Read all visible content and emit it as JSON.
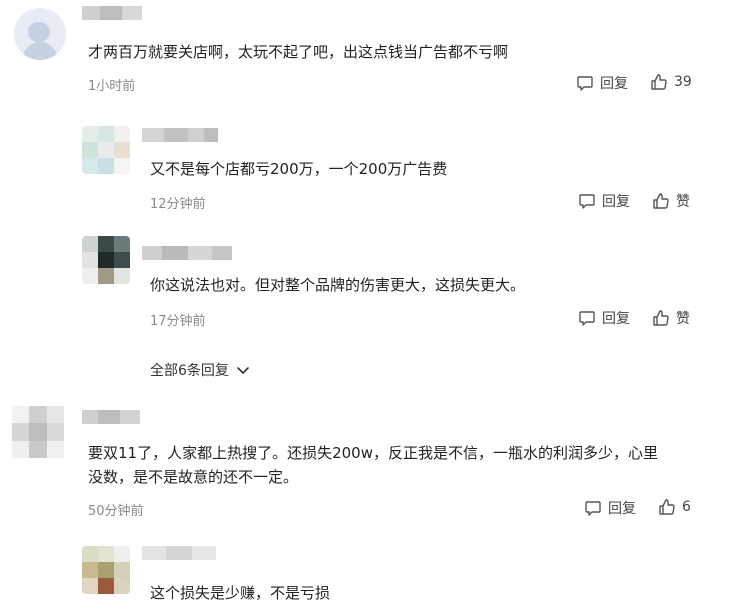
{
  "comments": [
    {
      "text": "才两百万就要关店啊，太玩不起了吧，出这点钱当广告都不亏啊",
      "time": "1小时前",
      "reply_label": "回复",
      "like_label": "39"
    },
    {
      "text": "又不是每个店都亏200万，一个200万广告费",
      "time": "12分钟前",
      "reply_label": "回复",
      "like_label": "赞"
    },
    {
      "text": "你这说法也对。但对整个品牌的伤害更大，这损失更大。",
      "time": "17分钟前",
      "reply_label": "回复",
      "like_label": "赞"
    },
    {
      "text_line1": "要双11了，人家都上热搜了。还损失200w，反正我是不信，一瓶水的利润多少，心里",
      "text_line2": "没数，是不是故意的还不一定。",
      "time": "50分钟前",
      "reply_label": "回复",
      "like_label": "6"
    },
    {
      "text": "这个损失是少赚，不是亏损"
    }
  ],
  "more_replies": {
    "label": "全部6条回复",
    "icon": "chevron-down-icon"
  },
  "colors": {
    "text": "#222222",
    "muted": "#8a8a8a",
    "icon": "#555555"
  }
}
